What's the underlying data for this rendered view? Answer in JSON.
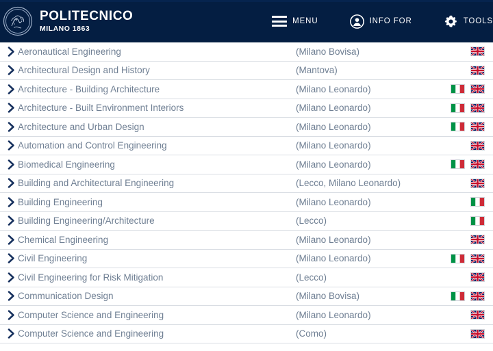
{
  "header": {
    "logo_icon": "polimi-seal-icon",
    "brand_main": "POLITECNICO",
    "brand_sub": "MILANO 1863",
    "background_color": "#041e42",
    "nav": [
      {
        "label": "MENU",
        "icon": "hamburger-menu-icon"
      },
      {
        "label": "INFO FOR",
        "icon": "person-icon"
      },
      {
        "label": "TOOLS",
        "icon": "gear-icon"
      }
    ]
  },
  "list": {
    "row_icon": "chevron-right-icon",
    "text_color": "#6f7f93",
    "flag_labels": {
      "it": "Italian",
      "en": "English"
    },
    "rows": [
      {
        "name": "Aeronautical Engineering",
        "campus": "(Milano Bovisa)",
        "flags": [
          "en"
        ]
      },
      {
        "name": "Architectural Design and History",
        "campus": "(Mantova)",
        "flags": [
          "en"
        ]
      },
      {
        "name": "Architecture - Building Architecture",
        "campus": "(Milano Leonardo)",
        "flags": [
          "it",
          "en"
        ]
      },
      {
        "name": "Architecture - Built Environment Interiors",
        "campus": "(Milano Leonardo)",
        "flags": [
          "it",
          "en"
        ]
      },
      {
        "name": "Architecture and Urban Design",
        "campus": "(Milano Leonardo)",
        "flags": [
          "it",
          "en"
        ]
      },
      {
        "name": "Automation and Control Engineering",
        "campus": "(Milano Leonardo)",
        "flags": [
          "en"
        ]
      },
      {
        "name": "Biomedical Engineering",
        "campus": "(Milano Leonardo)",
        "flags": [
          "it",
          "en"
        ]
      },
      {
        "name": "Building and Architectural Engineering",
        "campus": "(Lecco, Milano Leonardo)",
        "flags": [
          "en"
        ]
      },
      {
        "name": "Building Engineering",
        "campus": "(Milano Leonardo)",
        "flags": [
          "it"
        ]
      },
      {
        "name": "Building Engineering/Architecture",
        "campus": "(Lecco)",
        "flags": [
          "it"
        ]
      },
      {
        "name": "Chemical Engineering",
        "campus": "(Milano Leonardo)",
        "flags": [
          "en"
        ]
      },
      {
        "name": "Civil Engineering",
        "campus": "(Milano Leonardo)",
        "flags": [
          "it",
          "en"
        ]
      },
      {
        "name": "Civil Engineering for Risk Mitigation",
        "campus": "(Lecco)",
        "flags": [
          "en"
        ]
      },
      {
        "name": "Communication Design",
        "campus": "(Milano Bovisa)",
        "flags": [
          "it",
          "en"
        ]
      },
      {
        "name": "Computer Science and Engineering",
        "campus": "(Milano Leonardo)",
        "flags": [
          "en"
        ]
      },
      {
        "name": "Computer Science and Engineering",
        "campus": "(Como)",
        "flags": [
          "en"
        ]
      }
    ]
  }
}
